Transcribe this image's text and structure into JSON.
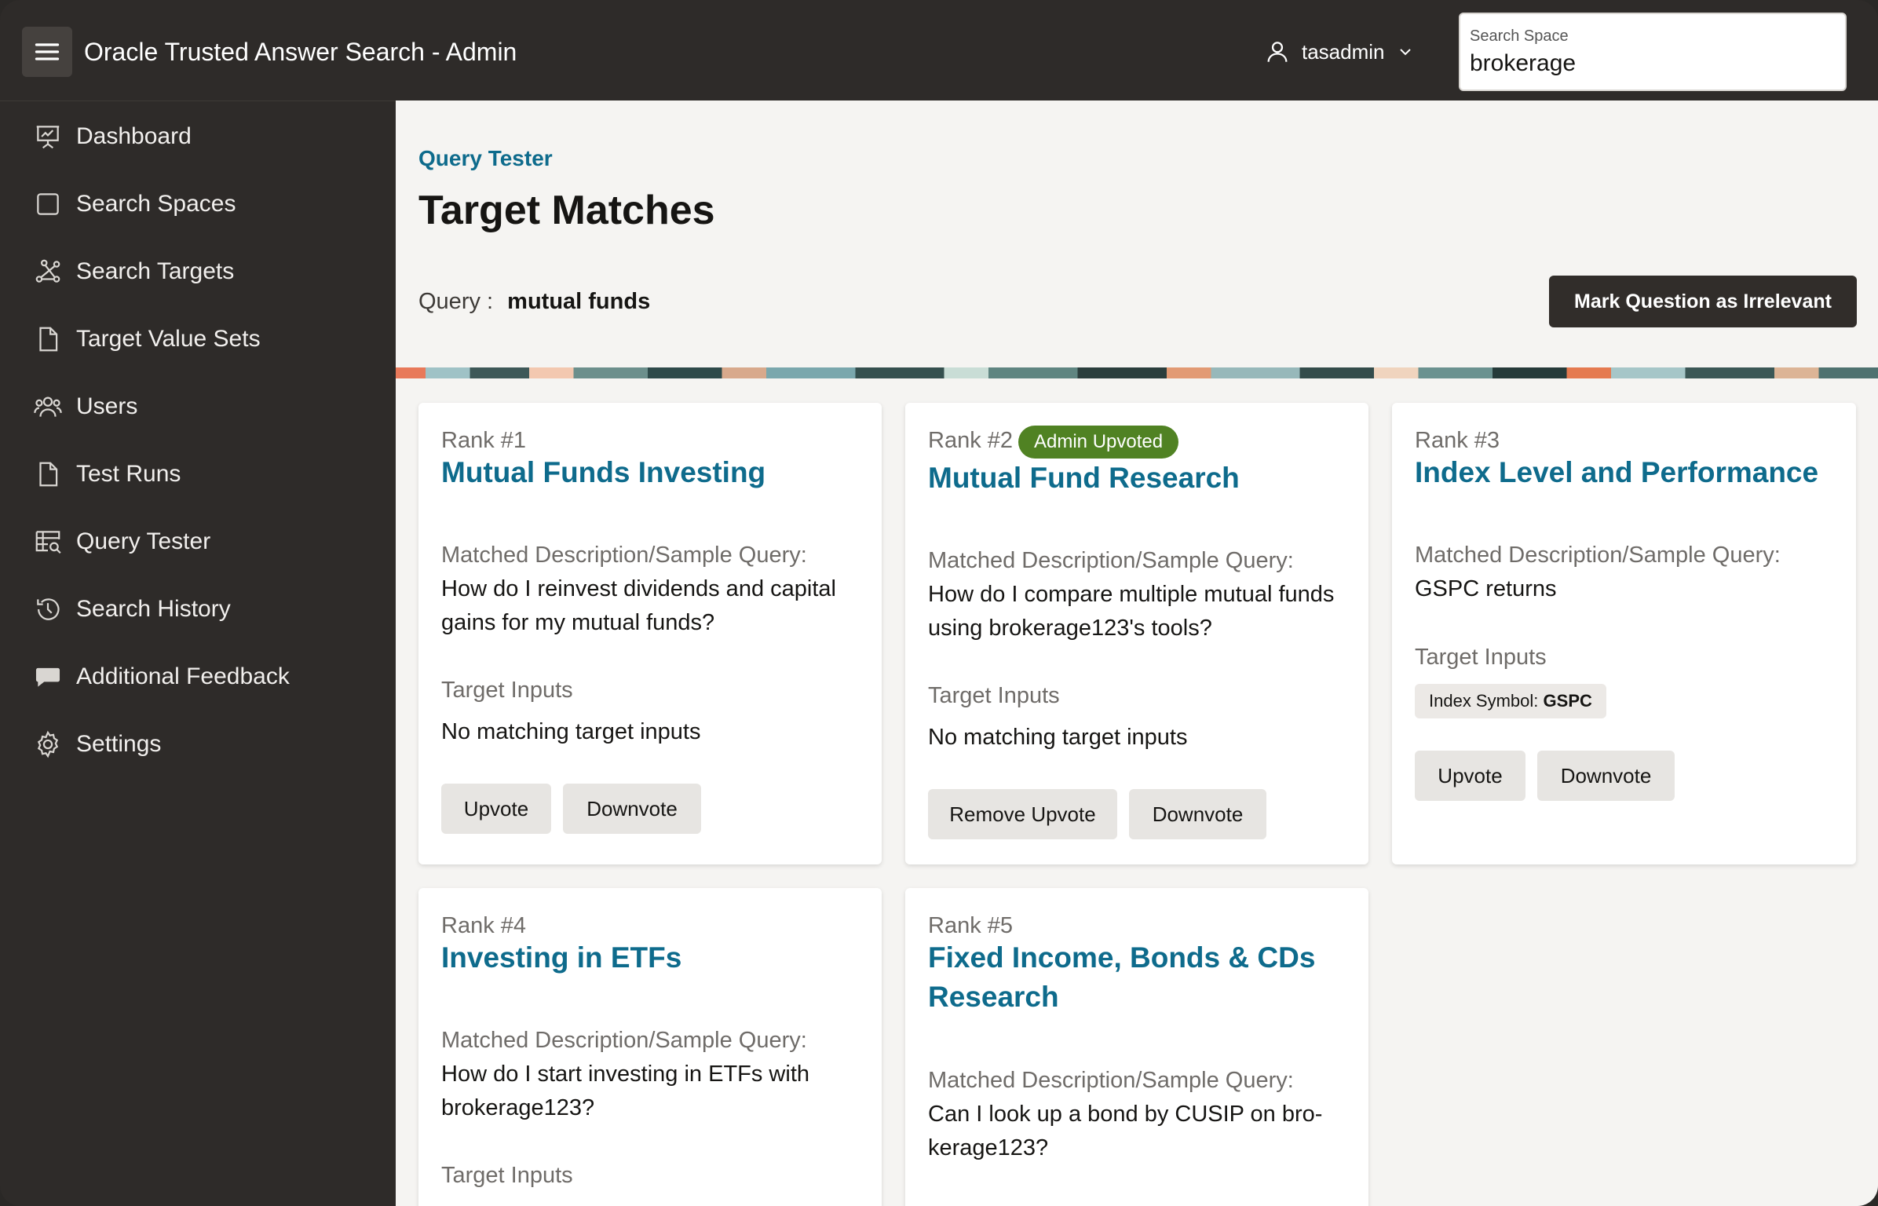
{
  "header": {
    "app_title": "Oracle Trusted Answer Search - Admin",
    "user_name": "tasadmin",
    "search_space_label": "Search Space",
    "search_space_value": "brokerage"
  },
  "sidebar": {
    "items": [
      {
        "label": "Dashboard",
        "icon": "presentation-chart-icon"
      },
      {
        "label": "Search Spaces",
        "icon": "square-icon"
      },
      {
        "label": "Search Targets",
        "icon": "nodes-icon"
      },
      {
        "label": "Target Value Sets",
        "icon": "document-icon"
      },
      {
        "label": "Users",
        "icon": "users-icon"
      },
      {
        "label": "Test Runs",
        "icon": "document-icon"
      },
      {
        "label": "Query Tester",
        "icon": "table-search-icon"
      },
      {
        "label": "Search History",
        "icon": "history-icon"
      },
      {
        "label": "Additional Feedback",
        "icon": "chat-bubble-icon"
      },
      {
        "label": "Settings",
        "icon": "gear-icon"
      }
    ]
  },
  "main": {
    "breadcrumb": "Query Tester",
    "title": "Target Matches",
    "query_label": "Query :",
    "query_value": "mutual funds",
    "mark_irrelevant_label": "Mark Question as Irrelevant"
  },
  "cards": [
    {
      "rank": "Rank #1",
      "title": "Mutual Funds Investing",
      "desc_label": "Matched Description/Sample Query:",
      "desc_text": "How do I reinvest dividends and capital gains for my mutual funds?",
      "inputs_label": "Target Inputs",
      "inputs_text": "No matching target inputs",
      "btn1": "Upvote",
      "btn2": "Downvote"
    },
    {
      "rank": "Rank #2",
      "badge": "Admin Upvoted",
      "title": "Mutual Fund Research",
      "desc_label": "Matched Description/Sample Query:",
      "desc_text": "How do I compare multiple mutual funds using brokerage123's tools?",
      "inputs_label": "Target Inputs",
      "inputs_text": "No matching target inputs",
      "btn1": "Remove Upvote",
      "btn2": "Downvote"
    },
    {
      "rank": "Rank #3",
      "title": "Index Level and Performance",
      "desc_label": "Matched Description/Sample Query:",
      "desc_text": "GSPC returns",
      "inputs_label": "Target Inputs",
      "chip_label": "Index Symbol:",
      "chip_value": "GSPC",
      "btn1": "Upvote",
      "btn2": "Downvote"
    },
    {
      "rank": "Rank #4",
      "title": "Investing in ETFs",
      "desc_label": "Matched Description/Sample Query:",
      "desc_text": "How do I start investing in ETFs with brokerage123?",
      "inputs_label": "Target Inputs"
    },
    {
      "rank": "Rank #5",
      "title": "Fixed Income, Bonds & CDs Research",
      "desc_label": "Matched Description/Sample Query:",
      "desc_text": "Can I look up a bond by CUSIP on bro-kerage123?"
    }
  ],
  "colors": {
    "header_bg": "#2e2b29",
    "accent_link": "#0e6b8c",
    "badge_green": "#508223",
    "primary_button": "#312d2a"
  }
}
